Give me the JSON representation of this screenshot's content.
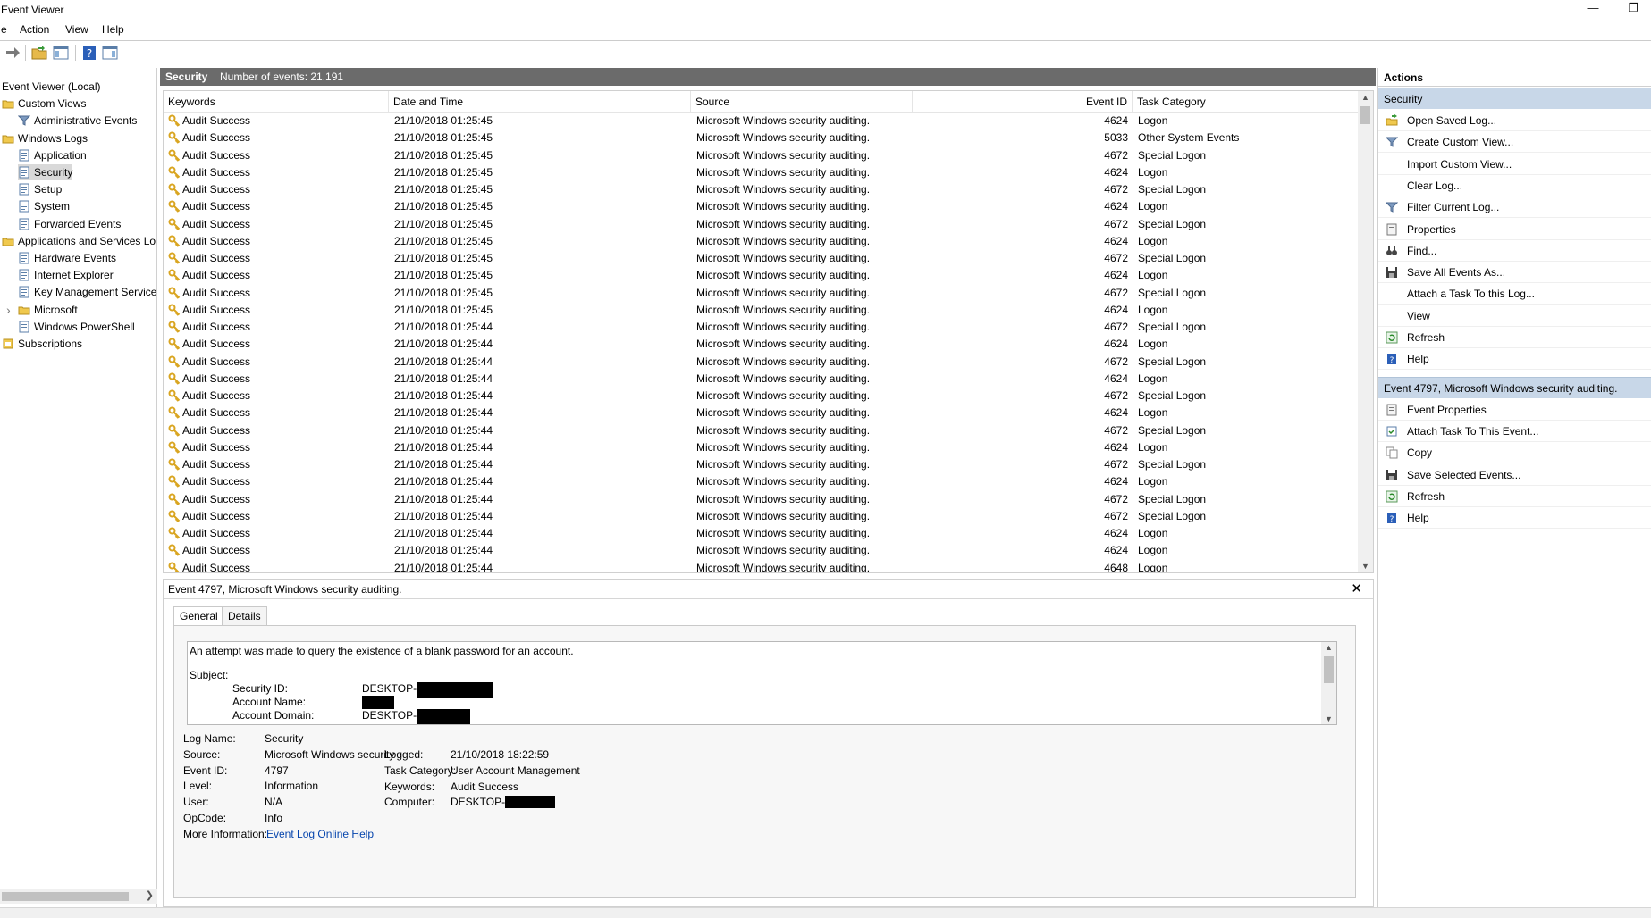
{
  "window": {
    "title": "Event Viewer"
  },
  "menu": [
    "e",
    "Action",
    "View",
    "Help"
  ],
  "tree": [
    {
      "label": "Event Viewer (Local)",
      "level": 0,
      "icon": "computer-icon"
    },
    {
      "label": "Custom Views",
      "level": 0,
      "icon": "folder-icon"
    },
    {
      "label": "Administrative Events",
      "level": 1,
      "icon": "filter-icon"
    },
    {
      "label": "Windows Logs",
      "level": 0,
      "icon": "folder-icon"
    },
    {
      "label": "Application",
      "level": 1,
      "icon": "log-icon"
    },
    {
      "label": "Security",
      "level": 1,
      "icon": "log-icon",
      "selected": true
    },
    {
      "label": "Setup",
      "level": 1,
      "icon": "log-icon"
    },
    {
      "label": "System",
      "level": 1,
      "icon": "log-icon"
    },
    {
      "label": "Forwarded Events",
      "level": 1,
      "icon": "log-icon"
    },
    {
      "label": "Applications and Services Lo",
      "level": 0,
      "icon": "folder-icon"
    },
    {
      "label": "Hardware Events",
      "level": 1,
      "icon": "log-icon"
    },
    {
      "label": "Internet Explorer",
      "level": 1,
      "icon": "log-icon"
    },
    {
      "label": "Key Management Service",
      "level": 1,
      "icon": "log-icon"
    },
    {
      "label": "Microsoft",
      "level": 1,
      "icon": "folder-icon",
      "expander": true
    },
    {
      "label": "Windows PowerShell",
      "level": 1,
      "icon": "log-icon"
    },
    {
      "label": "Subscriptions",
      "level": 0,
      "icon": "subscription-icon"
    }
  ],
  "center": {
    "log_name": "Security",
    "count_text": "Number of events: 21.191",
    "columns": [
      "Keywords",
      "Date and Time",
      "Source",
      "Event ID",
      "Task Category"
    ],
    "rows": [
      [
        "Audit Success",
        "21/10/2018 01:25:45",
        "Microsoft Windows security auditing.",
        "4624",
        "Logon"
      ],
      [
        "Audit Success",
        "21/10/2018 01:25:45",
        "Microsoft Windows security auditing.",
        "5033",
        "Other System Events"
      ],
      [
        "Audit Success",
        "21/10/2018 01:25:45",
        "Microsoft Windows security auditing.",
        "4672",
        "Special Logon"
      ],
      [
        "Audit Success",
        "21/10/2018 01:25:45",
        "Microsoft Windows security auditing.",
        "4624",
        "Logon"
      ],
      [
        "Audit Success",
        "21/10/2018 01:25:45",
        "Microsoft Windows security auditing.",
        "4672",
        "Special Logon"
      ],
      [
        "Audit Success",
        "21/10/2018 01:25:45",
        "Microsoft Windows security auditing.",
        "4624",
        "Logon"
      ],
      [
        "Audit Success",
        "21/10/2018 01:25:45",
        "Microsoft Windows security auditing.",
        "4672",
        "Special Logon"
      ],
      [
        "Audit Success",
        "21/10/2018 01:25:45",
        "Microsoft Windows security auditing.",
        "4624",
        "Logon"
      ],
      [
        "Audit Success",
        "21/10/2018 01:25:45",
        "Microsoft Windows security auditing.",
        "4672",
        "Special Logon"
      ],
      [
        "Audit Success",
        "21/10/2018 01:25:45",
        "Microsoft Windows security auditing.",
        "4624",
        "Logon"
      ],
      [
        "Audit Success",
        "21/10/2018 01:25:45",
        "Microsoft Windows security auditing.",
        "4672",
        "Special Logon"
      ],
      [
        "Audit Success",
        "21/10/2018 01:25:45",
        "Microsoft Windows security auditing.",
        "4624",
        "Logon"
      ],
      [
        "Audit Success",
        "21/10/2018 01:25:44",
        "Microsoft Windows security auditing.",
        "4672",
        "Special Logon"
      ],
      [
        "Audit Success",
        "21/10/2018 01:25:44",
        "Microsoft Windows security auditing.",
        "4624",
        "Logon"
      ],
      [
        "Audit Success",
        "21/10/2018 01:25:44",
        "Microsoft Windows security auditing.",
        "4672",
        "Special Logon"
      ],
      [
        "Audit Success",
        "21/10/2018 01:25:44",
        "Microsoft Windows security auditing.",
        "4624",
        "Logon"
      ],
      [
        "Audit Success",
        "21/10/2018 01:25:44",
        "Microsoft Windows security auditing.",
        "4672",
        "Special Logon"
      ],
      [
        "Audit Success",
        "21/10/2018 01:25:44",
        "Microsoft Windows security auditing.",
        "4624",
        "Logon"
      ],
      [
        "Audit Success",
        "21/10/2018 01:25:44",
        "Microsoft Windows security auditing.",
        "4672",
        "Special Logon"
      ],
      [
        "Audit Success",
        "21/10/2018 01:25:44",
        "Microsoft Windows security auditing.",
        "4624",
        "Logon"
      ],
      [
        "Audit Success",
        "21/10/2018 01:25:44",
        "Microsoft Windows security auditing.",
        "4672",
        "Special Logon"
      ],
      [
        "Audit Success",
        "21/10/2018 01:25:44",
        "Microsoft Windows security auditing.",
        "4624",
        "Logon"
      ],
      [
        "Audit Success",
        "21/10/2018 01:25:44",
        "Microsoft Windows security auditing.",
        "4672",
        "Special Logon"
      ],
      [
        "Audit Success",
        "21/10/2018 01:25:44",
        "Microsoft Windows security auditing.",
        "4672",
        "Special Logon"
      ],
      [
        "Audit Success",
        "21/10/2018 01:25:44",
        "Microsoft Windows security auditing.",
        "4624",
        "Logon"
      ],
      [
        "Audit Success",
        "21/10/2018 01:25:44",
        "Microsoft Windows security auditing.",
        "4624",
        "Logon"
      ],
      [
        "Audit Success",
        "21/10/2018 01:25:44",
        "Microsoft Windows security auditing.",
        "4648",
        "Logon"
      ]
    ]
  },
  "detail": {
    "title": "Event 4797, Microsoft Windows security auditing.",
    "tabs": [
      "General",
      "Details"
    ],
    "description": "An attempt was made to query the existence of a blank password for an account.",
    "subject_label": "Subject:",
    "subject": [
      {
        "label": "Security ID:",
        "value": "DESKTOP-"
      },
      {
        "label": "Account Name:",
        "value": ""
      },
      {
        "label": "Account Domain:",
        "value": "DESKTOP-"
      }
    ],
    "fields_left": [
      {
        "label": "Log Name:",
        "value": "Security"
      },
      {
        "label": "Source:",
        "value": "Microsoft Windows security"
      },
      {
        "label": "Event ID:",
        "value": "4797"
      },
      {
        "label": "Level:",
        "value": "Information"
      },
      {
        "label": "User:",
        "value": "N/A"
      },
      {
        "label": "OpCode:",
        "value": "Info"
      },
      {
        "label": "More Information:",
        "value": "Event Log Online Help"
      }
    ],
    "fields_right": [
      {
        "label": "Logged:",
        "value": "21/10/2018 18:22:59"
      },
      {
        "label": "Task Category:",
        "value": "User Account Management"
      },
      {
        "label": "Keywords:",
        "value": "Audit Success"
      },
      {
        "label": "Computer:",
        "value": "DESKTOP-"
      }
    ]
  },
  "actions": {
    "header": "Actions",
    "sections": [
      {
        "title": "Security",
        "items": [
          {
            "label": "Open Saved Log...",
            "icon": "open-folder-icon"
          },
          {
            "label": "Create Custom View...",
            "icon": "filter-icon"
          },
          {
            "label": "Import Custom View...",
            "icon": ""
          },
          {
            "label": "Clear Log...",
            "icon": ""
          },
          {
            "label": "Filter Current Log...",
            "icon": "filter-icon"
          },
          {
            "label": "Properties",
            "icon": "properties-icon"
          },
          {
            "label": "Find...",
            "icon": "binoculars-icon"
          },
          {
            "label": "Save All Events As...",
            "icon": "save-icon"
          },
          {
            "label": "Attach a Task To this Log...",
            "icon": ""
          },
          {
            "label": "View",
            "icon": ""
          },
          {
            "label": "Refresh",
            "icon": "refresh-icon"
          },
          {
            "label": "Help",
            "icon": "help-icon"
          }
        ]
      },
      {
        "title": "Event 4797, Microsoft Windows security auditing.",
        "items": [
          {
            "label": "Event Properties",
            "icon": "properties-icon"
          },
          {
            "label": "Attach Task To This Event...",
            "icon": "task-icon"
          },
          {
            "label": "Copy",
            "icon": "copy-icon"
          },
          {
            "label": "Save Selected Events...",
            "icon": "save-icon"
          },
          {
            "label": "Refresh",
            "icon": "refresh-icon"
          },
          {
            "label": "Help",
            "icon": "help-icon"
          }
        ]
      }
    ]
  },
  "colors": {
    "section_header": "#6b6b6b",
    "action_section": "#c8d7e8",
    "link": "#0645ad",
    "key_icon": "#d9a520"
  }
}
